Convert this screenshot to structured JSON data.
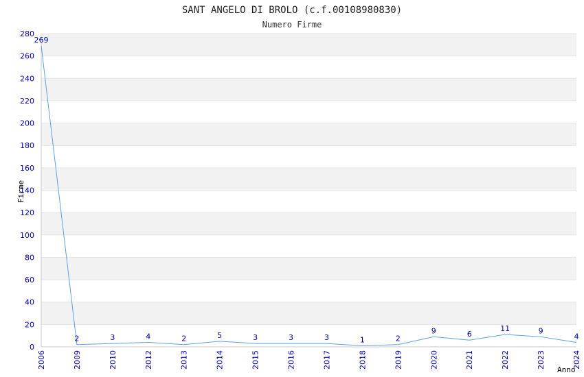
{
  "chart_data": {
    "type": "line",
    "title": "SANT ANGELO DI BROLO (c.f.00108980830)",
    "subtitle": "Numero Firme",
    "xlabel": "Anno",
    "ylabel": "Firme",
    "x": [
      "2006",
      "2009",
      "2010",
      "2012",
      "2013",
      "2014",
      "2015",
      "2016",
      "2017",
      "2018",
      "2019",
      "2020",
      "2021",
      "2022",
      "2023",
      "2024"
    ],
    "values": [
      269,
      2,
      3,
      4,
      2,
      5,
      3,
      3,
      3,
      1,
      2,
      9,
      6,
      11,
      9,
      4
    ],
    "ylim": [
      0,
      280
    ],
    "ystep": 20,
    "grid": true,
    "band_colors": [
      "#f2f2f2",
      "#ffffff"
    ],
    "line_color": "#5aa0e6",
    "text_color": "#0000aa"
  }
}
